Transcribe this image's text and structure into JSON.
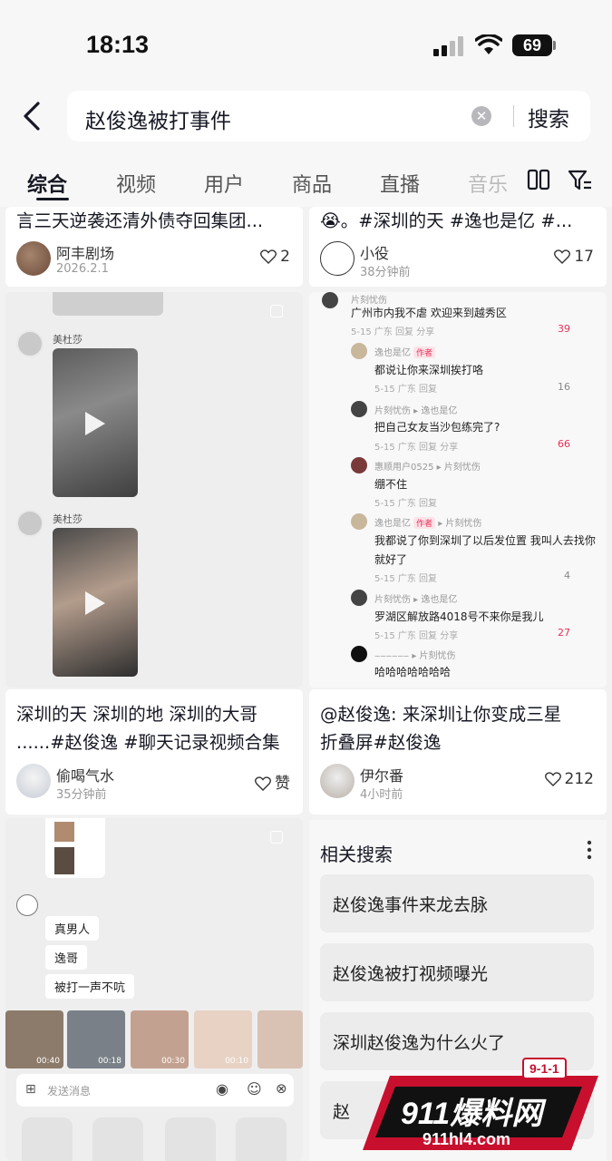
{
  "status_bar": {
    "time": "18:13",
    "battery": "69"
  },
  "search": {
    "query": "赵俊逸被打事件",
    "button": "搜索"
  },
  "tabs": [
    "综合",
    "视频",
    "用户",
    "商品",
    "直播",
    "音乐"
  ],
  "cards": {
    "top_left": {
      "title": "言三天逆袭还清外债夺回集团...",
      "author": "阿丰剧场",
      "time": "2026.2.1",
      "likes": "2"
    },
    "top_right": {
      "title": "😭。#深圳的天 #逸也是亿 #...",
      "author": "小役",
      "time": "38分钟前",
      "likes": "17"
    },
    "mid_left": {
      "title_line1": "深圳的天 深圳的地 深圳的大哥",
      "title_line2": "......#赵俊逸 #聊天记录视频合集",
      "author": "偷喝气水",
      "time": "35分钟前",
      "likes": "赞",
      "chat_user": "美杜莎"
    },
    "mid_right": {
      "title_line1": "@赵俊逸: 来深圳让你变成三星",
      "title_line2": "折叠屏#赵俊逸",
      "author": "伊尔番",
      "time": "4小时前",
      "likes": "212"
    }
  },
  "comments": [
    {
      "user": "片刻忧伤",
      "text": "广州市内我不虐 欢迎来到越秀区",
      "meta": "5-15  广东    回复    分享",
      "likes": "39",
      "hot": true
    },
    {
      "user": "逸也是亿",
      "badge": "作者",
      "text": "都说让你来深圳挨打咯",
      "meta": "5-15  广东    回复",
      "likes": "16",
      "hot": false
    },
    {
      "user": "片刻忧伤 ▸ 逸也是亿",
      "text": "把自己女友当沙包练完了?",
      "meta": "5-15  广东    回复    分享",
      "likes": "66",
      "hot": true
    },
    {
      "user": "惠顺用户0525 ▸ 片刻忧伤",
      "text": "绷不住",
      "meta": "5-15  广东    回复",
      "likes": "",
      "hot": false
    },
    {
      "user": "逸也是亿",
      "badge": "作者",
      "reply_to": "▸ 片刻忧伤",
      "text": "我都说了你到深圳了以后发位置 我叫人去找你",
      "text2": "就好了",
      "meta": "5-15  广东    回复",
      "likes": "4",
      "hot": false
    },
    {
      "user": "片刻忧伤 ▸ 逸也是亿",
      "text": "罗湖区解放路4018号不来你是我儿",
      "meta": "5-15  广东    回复    分享",
      "likes": "27",
      "hot": true
    },
    {
      "user": "‒‒‒‒‒‒ ▸ 片刻忧伤",
      "text": "哈哈哈哈哈哈哈",
      "meta": "",
      "likes": "",
      "hot": false
    }
  ],
  "chat_bottom": {
    "messages": [
      "真男人",
      "逸哥",
      "被打一声不吭"
    ],
    "input_placeholder": "发送消息",
    "durations": [
      "00:40",
      "00:18",
      "00:30",
      "00:10"
    ]
  },
  "related": {
    "title": "相关搜索",
    "items": [
      "赵俊逸事件来龙去脉",
      "赵俊逸被打视频曝光",
      "深圳赵俊逸为什么火了",
      "赵"
    ]
  },
  "watermark": {
    "brand": "911爆料网",
    "url": "911hl4.com",
    "badge": "9-1-1"
  },
  "colors": {
    "accent": "#e8315a",
    "text": "#161823",
    "page_bg": "#f2f2f2"
  }
}
